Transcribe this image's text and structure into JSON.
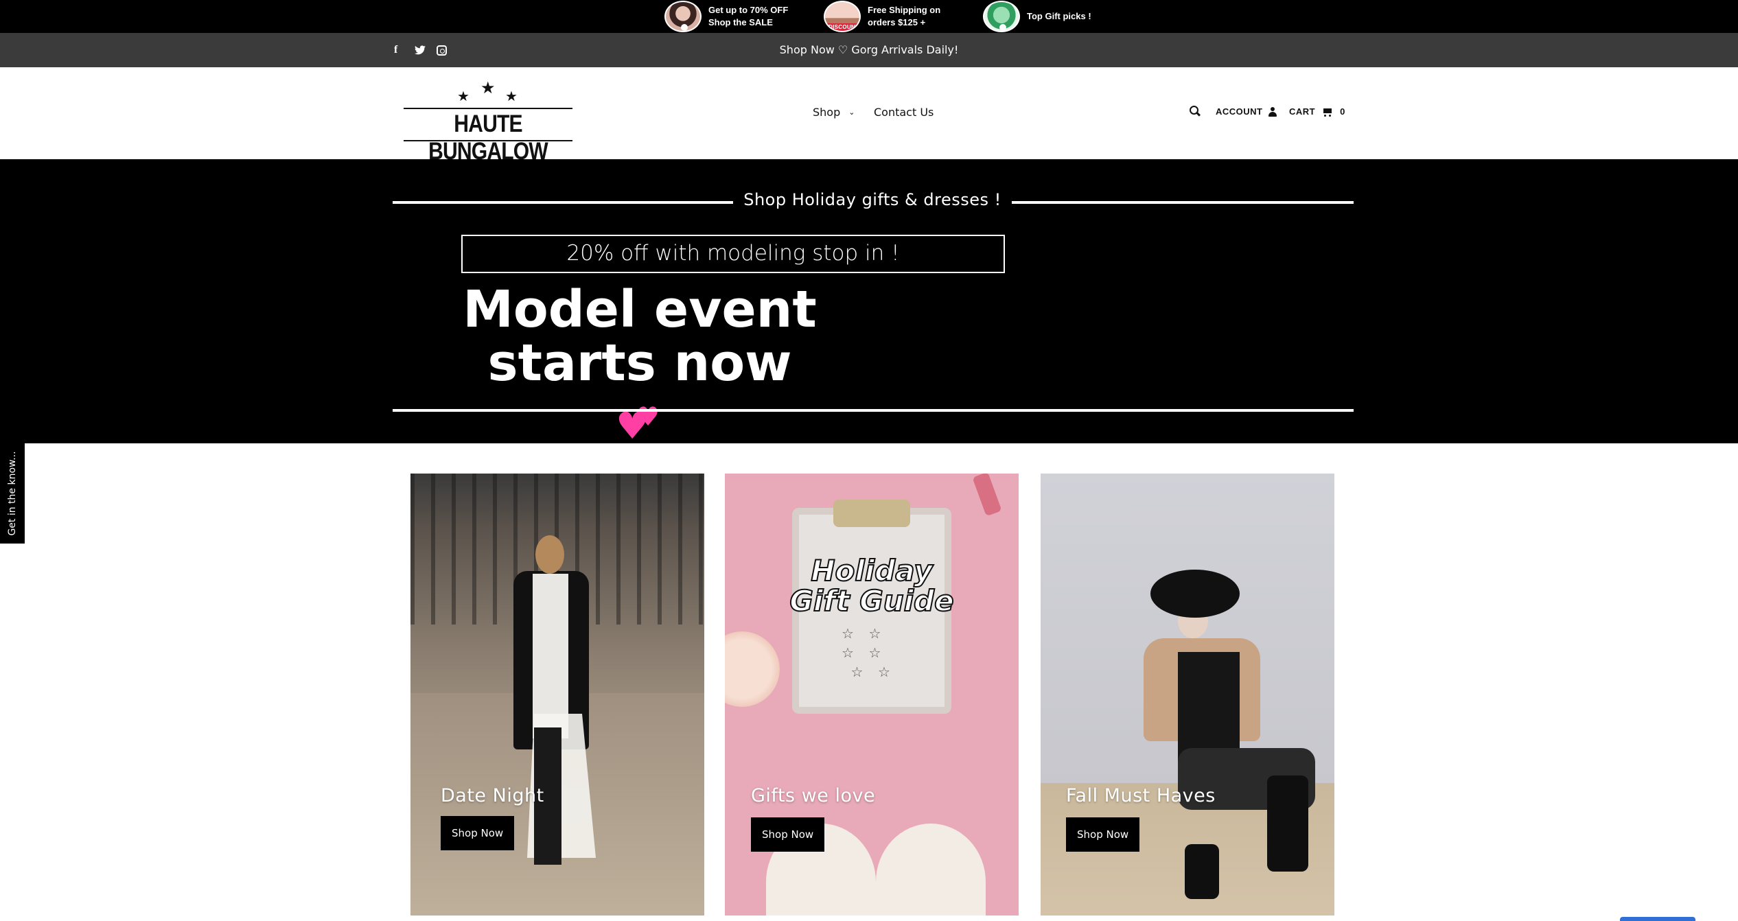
{
  "promos": [
    {
      "text": "Get up to 70% OFF\nShop the SALE",
      "thumb_icon": "sale-thumbnail"
    },
    {
      "text": "Free Shipping on\norders $125 +",
      "thumb_icon": "discount-box-thumbnail",
      "badge": "DISCOUNT"
    },
    {
      "text": "Top Gift picks !",
      "thumb_icon": "gift-thumbnail"
    }
  ],
  "announcement": {
    "text": "Shop Now ♡ Gorg Arrivals Daily!",
    "social_icons": [
      "facebook-icon",
      "twitter-icon",
      "instagram-icon"
    ]
  },
  "header": {
    "logo_text": "HAUTE BUNGALOW",
    "nav": {
      "shop": "Shop",
      "contact": "Contact Us"
    },
    "account_label": "ACCOUNT",
    "cart_label": "CART",
    "cart_count": "0"
  },
  "hero": {
    "title": "Shop Holiday gifts & dresses !",
    "box_text": "20% off with modeling stop in !",
    "headline_line1": "Model event",
    "headline_line2": "starts now"
  },
  "side_tab": {
    "label": "Get in the know..."
  },
  "cards": [
    {
      "title": "Date Night",
      "button": "Shop Now"
    },
    {
      "title": "Gifts we love",
      "button": "Shop Now",
      "image_text": "Holiday\nGift Guide"
    },
    {
      "title": "Fall Must Haves",
      "button": "Shop Now"
    }
  ],
  "colors": {
    "promo_bar": "#000000",
    "announcement_bar": "#3b3b3b",
    "hero_bg": "#000000",
    "heart": "#ff3fa4",
    "button_bg": "#000000"
  }
}
